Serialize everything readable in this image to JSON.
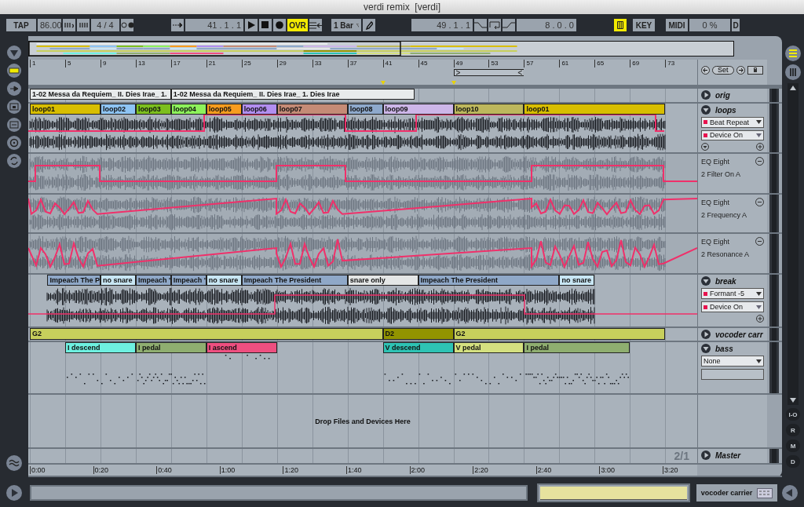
{
  "window": {
    "title": "verdi remix  [verdi]"
  },
  "transport": {
    "tap": "TAP",
    "tempo": "86.00",
    "signature": "4 / 4",
    "position": "41 .  1 .  1",
    "overdub": {
      "label": "OVR",
      "on": true
    },
    "quantize": "1 Bar",
    "loop_start": "49 .  1 .  1",
    "loop_length": "8 .  0 .  0",
    "computer_keyboard_on": true,
    "key_map": "KEY",
    "midi_map": "MIDI",
    "cpu": "0 %",
    "disk": "D"
  },
  "bar_ruler": [
    "1",
    "5",
    "9",
    "13",
    "17",
    "21",
    "25",
    "29",
    "33",
    "37",
    "41",
    "45",
    "49",
    "53",
    "57",
    "61",
    "65",
    "69",
    "73"
  ],
  "locator": {
    "set": "Set"
  },
  "tracks": [
    {
      "kind": "audio",
      "name": "orig",
      "expanded": false,
      "clips": [
        {
          "name": "1-02 Messa da Requiem_ II. Dies Irae_ 1.",
          "color": "#e8ebec"
        },
        {
          "name": "1-02 Messa da Requiem_ II. Dies Irae_ 1. Dies Irae",
          "color": "#e8ebec"
        }
      ]
    },
    {
      "kind": "audio",
      "name": "loops",
      "expanded": true,
      "device": "Beat Repeat",
      "parameter": "Device On",
      "clips": [
        {
          "name": "loop01",
          "color": "#d8be00"
        },
        {
          "name": "loop02",
          "color": "#8ec4f4"
        },
        {
          "name": "loop03",
          "color": "#7cbf1e"
        },
        {
          "name": "loop04",
          "color": "#8df25b"
        },
        {
          "name": "loop05",
          "color": "#f89c1e"
        },
        {
          "name": "loop06",
          "color": "#b28ef0"
        },
        {
          "name": "loop07",
          "color": "#c58b76"
        },
        {
          "name": "loop08",
          "color": "#8ea9cc"
        },
        {
          "name": "loop09",
          "color": "#cdb6e8"
        },
        {
          "name": "loop10",
          "color": "#bdb75c"
        },
        {
          "name": "loop01",
          "color": "#d8be00"
        }
      ],
      "lanes": [
        {
          "device": "EQ Eight",
          "parameter": "2 Filter On A"
        },
        {
          "device": "EQ Eight",
          "parameter": "2 Frequency A"
        },
        {
          "device": "EQ Eight",
          "parameter": "2 Resonance A"
        }
      ]
    },
    {
      "kind": "audio",
      "name": "break",
      "expanded": true,
      "device": "Formant -5",
      "parameter": "Device On",
      "clips": [
        {
          "name": "Impeach The P",
          "color": "#8fa8c8"
        },
        {
          "name": "no snare",
          "color": "#c8e6f4"
        },
        {
          "name": "Impeach '",
          "color": "#8fa8c8"
        },
        {
          "name": "Impeach '",
          "color": "#8fa8c8"
        },
        {
          "name": "no snare",
          "color": "#c8e6f4"
        },
        {
          "name": "Impeach The President",
          "color": "#8fa8c8"
        },
        {
          "name": "snare only",
          "color": "#e4e6e6"
        },
        {
          "name": "Impeach The President",
          "color": "#8fa8c8"
        },
        {
          "name": "no snare",
          "color": "#c8e6f4"
        }
      ]
    },
    {
      "kind": "midi",
      "name": "vocoder carr",
      "expanded": false,
      "clips": [
        {
          "name": "G2",
          "color": "#c7cf5c"
        },
        {
          "name": "D2",
          "color": "#929400"
        },
        {
          "name": "G2",
          "color": "#c7cf5c"
        }
      ]
    },
    {
      "kind": "midi",
      "name": "bass",
      "expanded": true,
      "device": "None",
      "clips": [
        {
          "name": "I descend",
          "color": "#6ef0e0"
        },
        {
          "name": "I pedal",
          "color": "#8fae70"
        },
        {
          "name": "I ascend",
          "color": "#ee4f80"
        },
        {
          "name": "V descend",
          "color": "#2ec3b4"
        },
        {
          "name": "V pedal",
          "color": "#d4e080"
        },
        {
          "name": "I pedal",
          "color": "#8fae70"
        }
      ]
    }
  ],
  "drop_zone": "Drop Files and Devices Here",
  "master": {
    "name": "Master",
    "signature": "2/1"
  },
  "time_ruler": [
    "0:00",
    "0:20",
    "0:40",
    "1:00",
    "1:20",
    "1:40",
    "2:00",
    "2:20",
    "2:40",
    "3:00",
    "3:20"
  ],
  "view_buttons": [
    "I-O",
    "R",
    "M",
    "D"
  ],
  "status": {
    "track": "vocoder carrier"
  }
}
